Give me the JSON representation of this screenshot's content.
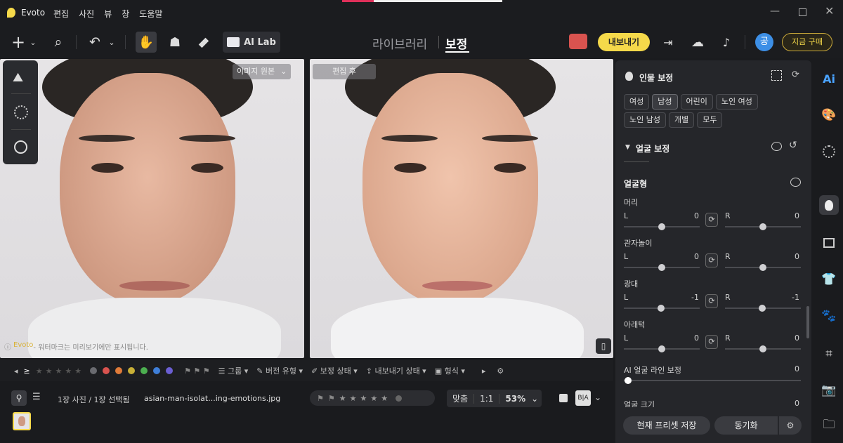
{
  "app": {
    "name": "Evoto",
    "menu": [
      "편집",
      "사진",
      "뷰",
      "창",
      "도움말"
    ]
  },
  "toolbar": {
    "ai_lab": "AI Lab",
    "tab_library": "라이브러리",
    "tab_edit": "보정",
    "export": "내보내기",
    "buy": "지금 구매",
    "avatar": "공"
  },
  "canvas": {
    "left_label": "이미지 원본",
    "right_label": "편집 후",
    "watermark_brand": "Evoto",
    "watermark_text": " - 워터마크는 미리보기에만 표시됩니다."
  },
  "bottom": {
    "group": "그룹",
    "version": "버전 유형",
    "status": "보정 상태",
    "export_status": "내보내기 상태",
    "format": "형식",
    "count": "1장 사진 / 1장 선택됨",
    "filename": "asian-man-isolat...ing-emotions.jpg",
    "fit": "맞춤",
    "ratio": "1:1",
    "zoom": "53%",
    "ba": "B|A"
  },
  "colors": {
    "accent": "#f5d94a",
    "red": "#d9534f",
    "orange": "#e07b39",
    "yellow": "#c9b037",
    "green": "#4caf50",
    "blue": "#3f7fd9",
    "purple": "#6b5fd3"
  },
  "panel": {
    "title": "인물 보정",
    "chips": [
      "여성",
      "남성",
      "어린이",
      "노인 여성",
      "노인 남성",
      "개별",
      "모두"
    ],
    "selected_chip": "남성",
    "section": "얼굴 보정",
    "subsection": "얼굴형",
    "sliders": [
      {
        "name": "머리",
        "l_label": "L",
        "l": "0",
        "r_label": "R",
        "r": "0"
      },
      {
        "name": "관자놀이",
        "l_label": "L",
        "l": "0",
        "r_label": "R",
        "r": "0"
      },
      {
        "name": "광대",
        "l_label": "L",
        "l": "-1",
        "r_label": "R",
        "r": "-1"
      },
      {
        "name": "아래턱",
        "l_label": "L",
        "l": "0",
        "r_label": "R",
        "r": "0"
      }
    ],
    "ai_line": {
      "name": "AI 얼굴 라인 보정",
      "value": "0"
    },
    "face_size": {
      "name": "얼굴 크기",
      "value": "0"
    },
    "save_preset": "현재 프리셋 저장",
    "sync": "동기화"
  }
}
